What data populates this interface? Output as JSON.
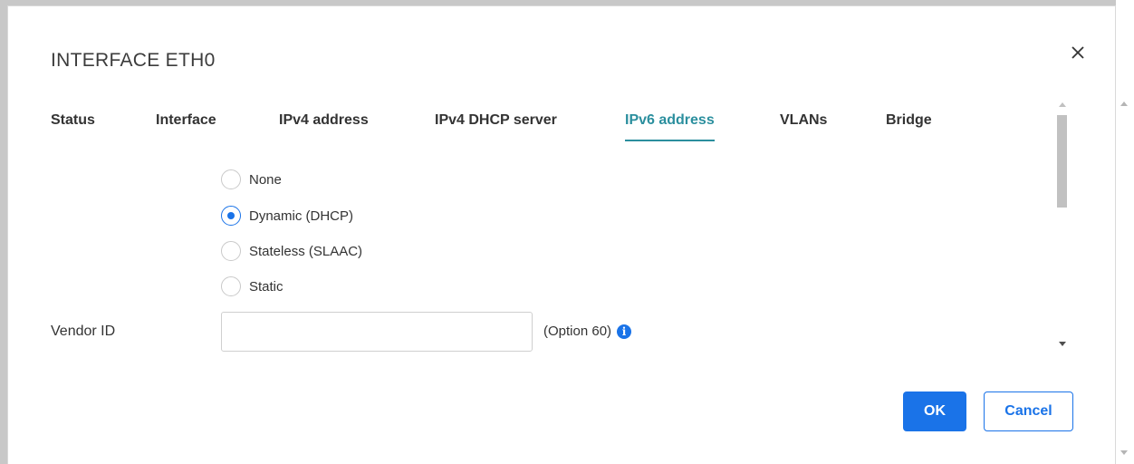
{
  "dialog": {
    "title": "INTERFACE ETH0",
    "close_icon": "close-icon"
  },
  "tabs": [
    {
      "label": "Status",
      "active": false
    },
    {
      "label": "Interface",
      "active": false
    },
    {
      "label": "IPv4 address",
      "active": false
    },
    {
      "label": "IPv4 DHCP server",
      "active": false
    },
    {
      "label": "IPv6 address",
      "active": true
    },
    {
      "label": "VLANs",
      "active": false
    },
    {
      "label": "Bridge",
      "active": false
    }
  ],
  "ipv6_mode": {
    "options": [
      {
        "label": "None",
        "checked": false
      },
      {
        "label": "Dynamic (DHCP)",
        "checked": true
      },
      {
        "label": "Stateless (SLAAC)",
        "checked": false
      },
      {
        "label": "Static",
        "checked": false
      }
    ],
    "selected": "Dynamic (DHCP)"
  },
  "vendor_id": {
    "label": "Vendor ID",
    "value": "",
    "placeholder": "",
    "hint": "(Option 60)",
    "info_icon": "info-icon"
  },
  "buttons": {
    "ok": "OK",
    "cancel": "Cancel"
  },
  "colors": {
    "accent": "#1a73e8",
    "active_tab": "#2b8f9e"
  }
}
